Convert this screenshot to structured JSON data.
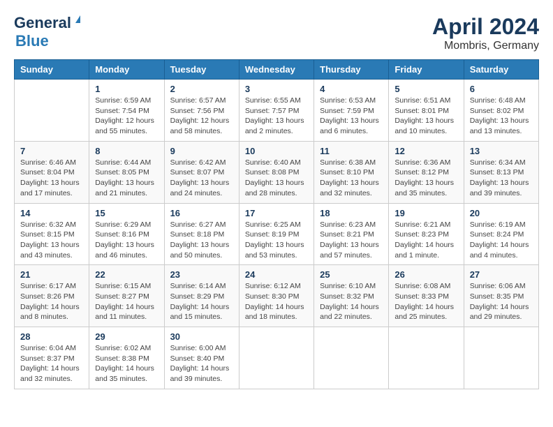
{
  "header": {
    "logo_line1": "General",
    "logo_line2": "Blue",
    "month_title": "April 2024",
    "location": "Mombris, Germany"
  },
  "weekdays": [
    "Sunday",
    "Monday",
    "Tuesday",
    "Wednesday",
    "Thursday",
    "Friday",
    "Saturday"
  ],
  "weeks": [
    [
      {
        "day": "",
        "info": ""
      },
      {
        "day": "1",
        "info": "Sunrise: 6:59 AM\nSunset: 7:54 PM\nDaylight: 12 hours\nand 55 minutes."
      },
      {
        "day": "2",
        "info": "Sunrise: 6:57 AM\nSunset: 7:56 PM\nDaylight: 12 hours\nand 58 minutes."
      },
      {
        "day": "3",
        "info": "Sunrise: 6:55 AM\nSunset: 7:57 PM\nDaylight: 13 hours\nand 2 minutes."
      },
      {
        "day": "4",
        "info": "Sunrise: 6:53 AM\nSunset: 7:59 PM\nDaylight: 13 hours\nand 6 minutes."
      },
      {
        "day": "5",
        "info": "Sunrise: 6:51 AM\nSunset: 8:01 PM\nDaylight: 13 hours\nand 10 minutes."
      },
      {
        "day": "6",
        "info": "Sunrise: 6:48 AM\nSunset: 8:02 PM\nDaylight: 13 hours\nand 13 minutes."
      }
    ],
    [
      {
        "day": "7",
        "info": "Sunrise: 6:46 AM\nSunset: 8:04 PM\nDaylight: 13 hours\nand 17 minutes."
      },
      {
        "day": "8",
        "info": "Sunrise: 6:44 AM\nSunset: 8:05 PM\nDaylight: 13 hours\nand 21 minutes."
      },
      {
        "day": "9",
        "info": "Sunrise: 6:42 AM\nSunset: 8:07 PM\nDaylight: 13 hours\nand 24 minutes."
      },
      {
        "day": "10",
        "info": "Sunrise: 6:40 AM\nSunset: 8:08 PM\nDaylight: 13 hours\nand 28 minutes."
      },
      {
        "day": "11",
        "info": "Sunrise: 6:38 AM\nSunset: 8:10 PM\nDaylight: 13 hours\nand 32 minutes."
      },
      {
        "day": "12",
        "info": "Sunrise: 6:36 AM\nSunset: 8:12 PM\nDaylight: 13 hours\nand 35 minutes."
      },
      {
        "day": "13",
        "info": "Sunrise: 6:34 AM\nSunset: 8:13 PM\nDaylight: 13 hours\nand 39 minutes."
      }
    ],
    [
      {
        "day": "14",
        "info": "Sunrise: 6:32 AM\nSunset: 8:15 PM\nDaylight: 13 hours\nand 43 minutes."
      },
      {
        "day": "15",
        "info": "Sunrise: 6:29 AM\nSunset: 8:16 PM\nDaylight: 13 hours\nand 46 minutes."
      },
      {
        "day": "16",
        "info": "Sunrise: 6:27 AM\nSunset: 8:18 PM\nDaylight: 13 hours\nand 50 minutes."
      },
      {
        "day": "17",
        "info": "Sunrise: 6:25 AM\nSunset: 8:19 PM\nDaylight: 13 hours\nand 53 minutes."
      },
      {
        "day": "18",
        "info": "Sunrise: 6:23 AM\nSunset: 8:21 PM\nDaylight: 13 hours\nand 57 minutes."
      },
      {
        "day": "19",
        "info": "Sunrise: 6:21 AM\nSunset: 8:23 PM\nDaylight: 14 hours\nand 1 minute."
      },
      {
        "day": "20",
        "info": "Sunrise: 6:19 AM\nSunset: 8:24 PM\nDaylight: 14 hours\nand 4 minutes."
      }
    ],
    [
      {
        "day": "21",
        "info": "Sunrise: 6:17 AM\nSunset: 8:26 PM\nDaylight: 14 hours\nand 8 minutes."
      },
      {
        "day": "22",
        "info": "Sunrise: 6:15 AM\nSunset: 8:27 PM\nDaylight: 14 hours\nand 11 minutes."
      },
      {
        "day": "23",
        "info": "Sunrise: 6:14 AM\nSunset: 8:29 PM\nDaylight: 14 hours\nand 15 minutes."
      },
      {
        "day": "24",
        "info": "Sunrise: 6:12 AM\nSunset: 8:30 PM\nDaylight: 14 hours\nand 18 minutes."
      },
      {
        "day": "25",
        "info": "Sunrise: 6:10 AM\nSunset: 8:32 PM\nDaylight: 14 hours\nand 22 minutes."
      },
      {
        "day": "26",
        "info": "Sunrise: 6:08 AM\nSunset: 8:33 PM\nDaylight: 14 hours\nand 25 minutes."
      },
      {
        "day": "27",
        "info": "Sunrise: 6:06 AM\nSunset: 8:35 PM\nDaylight: 14 hours\nand 29 minutes."
      }
    ],
    [
      {
        "day": "28",
        "info": "Sunrise: 6:04 AM\nSunset: 8:37 PM\nDaylight: 14 hours\nand 32 minutes."
      },
      {
        "day": "29",
        "info": "Sunrise: 6:02 AM\nSunset: 8:38 PM\nDaylight: 14 hours\nand 35 minutes."
      },
      {
        "day": "30",
        "info": "Sunrise: 6:00 AM\nSunset: 8:40 PM\nDaylight: 14 hours\nand 39 minutes."
      },
      {
        "day": "",
        "info": ""
      },
      {
        "day": "",
        "info": ""
      },
      {
        "day": "",
        "info": ""
      },
      {
        "day": "",
        "info": ""
      }
    ]
  ]
}
